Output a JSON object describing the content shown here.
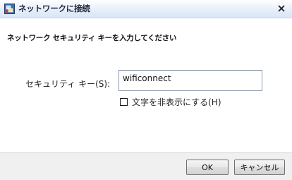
{
  "window": {
    "title": "ネットワークに接続"
  },
  "dialog": {
    "heading": "ネットワーク セキュリティ キーを入力してください",
    "security_key_label": "セキュリティ キー(S):",
    "security_key_value": "wificonnect",
    "hide_characters_label": "文字を非表示にする(H)",
    "hide_characters_checked": false
  },
  "buttons": {
    "ok_label": "OK",
    "cancel_label": "キャンセル"
  },
  "icons": {
    "app": "network-connection-icon",
    "close": "close-icon"
  }
}
